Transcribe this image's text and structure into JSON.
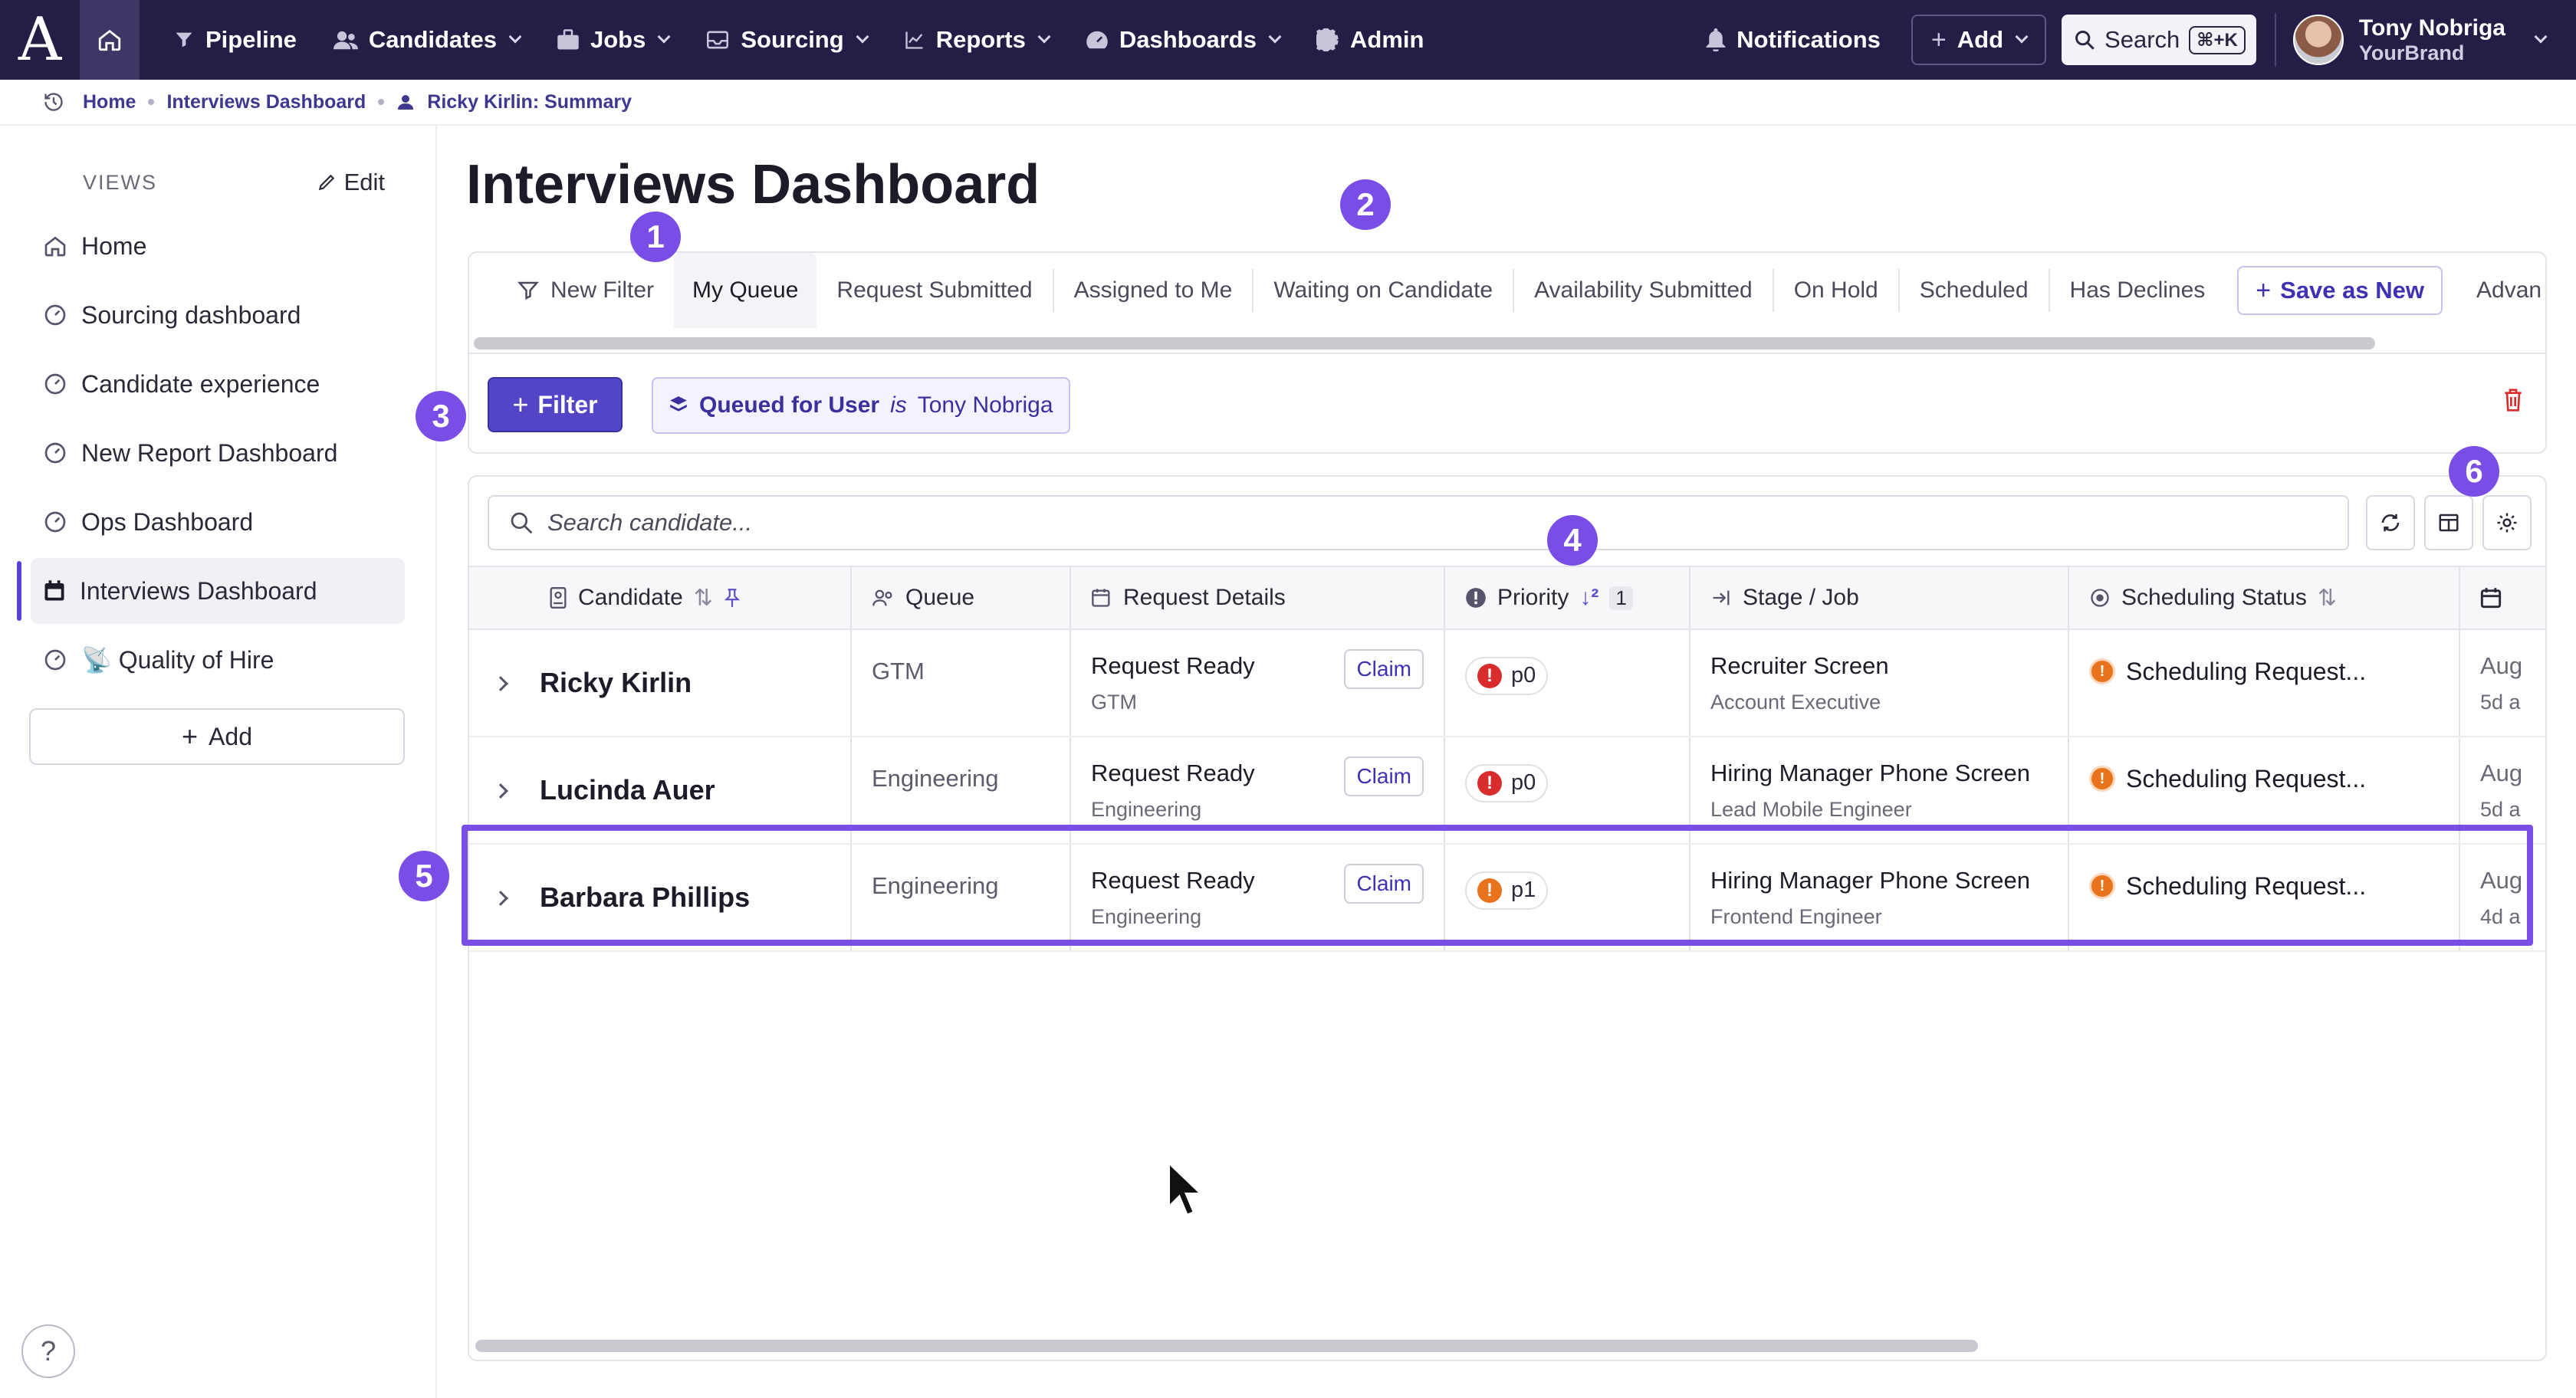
{
  "app": {
    "logo_letter": "A",
    "nav": [
      {
        "label": "Pipeline",
        "icon": "funnel-icon",
        "dropdown": false
      },
      {
        "label": "Candidates",
        "icon": "people-icon",
        "dropdown": true
      },
      {
        "label": "Jobs",
        "icon": "briefcase-icon",
        "dropdown": true
      },
      {
        "label": "Sourcing",
        "icon": "inbox-icon",
        "dropdown": true
      },
      {
        "label": "Reports",
        "icon": "chart-line-icon",
        "dropdown": true
      },
      {
        "label": "Dashboards",
        "icon": "gauge-icon",
        "dropdown": true
      },
      {
        "label": "Admin",
        "icon": "gear-icon",
        "dropdown": false
      }
    ],
    "notifications_label": "Notifications",
    "add_label": "Add",
    "search_label": "Search",
    "search_shortcut": "⌘+K",
    "user": {
      "name": "Tony Nobriga",
      "brand": "YourBrand"
    }
  },
  "breadcrumb": [
    "Home",
    "Interviews Dashboard",
    "Ricky Kirlin: Summary"
  ],
  "sidebar": {
    "views_label": "VIEWS",
    "edit_label": "Edit",
    "items": [
      {
        "label": "Home",
        "icon": "home-icon",
        "active": false
      },
      {
        "label": "Sourcing dashboard",
        "icon": "gauge-icon",
        "active": false
      },
      {
        "label": "Candidate experience",
        "icon": "gauge-icon",
        "active": false
      },
      {
        "label": "New Report Dashboard",
        "icon": "gauge-icon",
        "active": false
      },
      {
        "label": "Ops Dashboard",
        "icon": "gauge-icon",
        "active": false
      },
      {
        "label": "Interviews Dashboard",
        "icon": "calendar-icon",
        "active": true
      },
      {
        "label": "📡 Quality of Hire",
        "icon": "gauge-icon",
        "active": false
      }
    ],
    "add_label": "Add",
    "help_label": "?"
  },
  "main": {
    "title": "Interviews Dashboard",
    "tabs": [
      "New Filter",
      "My Queue",
      "Request Submitted",
      "Assigned to Me",
      "Waiting on Candidate",
      "Availability Submitted",
      "On Hold",
      "Scheduled",
      "Has Declines"
    ],
    "active_tab": "My Queue",
    "save_as_new_label": "Save as New",
    "advanced_label": "Advan",
    "filter_button": "Filter",
    "filter_chip": {
      "field": "Queued for User",
      "op": "is",
      "value": "Tony Nobriga"
    },
    "search_placeholder": "Search candidate..."
  },
  "table": {
    "columns": [
      "Candidate",
      "Queue",
      "Request Details",
      "Priority",
      "Stage / Job",
      "Scheduling Status",
      ""
    ],
    "priority_sort_index": "1",
    "rows": [
      {
        "candidate": "Ricky Kirlin",
        "queue": "GTM",
        "request": "Request Ready",
        "request_sub": "GTM",
        "claim": "Claim",
        "priority": "p0",
        "priority_color": "#d92d2d",
        "stage": "Recruiter Screen",
        "job": "Account Executive",
        "status": "Scheduling Request...",
        "date": "Aug",
        "ago": "5d a"
      },
      {
        "candidate": "Lucinda Auer",
        "queue": "Engineering",
        "request": "Request Ready",
        "request_sub": "Engineering",
        "claim": "Claim",
        "priority": "p0",
        "priority_color": "#d92d2d",
        "stage": "Hiring Manager Phone Screen",
        "job": "Lead Mobile Engineer",
        "status": "Scheduling Request...",
        "date": "Aug",
        "ago": "5d a"
      },
      {
        "candidate": "Barbara Phillips",
        "queue": "Engineering",
        "request": "Request Ready",
        "request_sub": "Engineering",
        "claim": "Claim",
        "priority": "p1",
        "priority_color": "#e8731c",
        "stage": "Hiring Manager Phone Screen",
        "job": "Frontend Engineer",
        "status": "Scheduling Request...",
        "date": "Aug",
        "ago": "4d a"
      }
    ]
  },
  "annotations": [
    "1",
    "2",
    "3",
    "4",
    "5",
    "6"
  ],
  "colors": {
    "nav_bg": "#241e46",
    "accent": "#5245c7",
    "annotation": "#7a4ee6",
    "p0": "#d92d2d",
    "p1": "#e8731c"
  }
}
